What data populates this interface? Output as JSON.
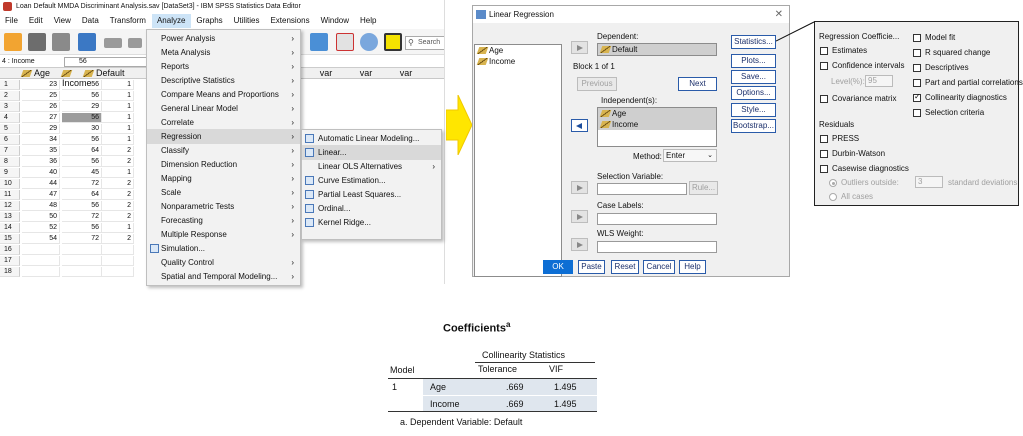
{
  "window": {
    "title": "Loan Default MMDA Discriminant Analysis.sav [DataSet3] - IBM SPSS Statistics Data Editor"
  },
  "menubar": [
    "File",
    "Edit",
    "View",
    "Data",
    "Transform",
    "Analyze",
    "Graphs",
    "Utilities",
    "Extensions",
    "Window",
    "Help"
  ],
  "toolbar": {
    "search_placeholder": "Search"
  },
  "cellbar": {
    "cell": "4 : Income",
    "value": "56"
  },
  "grid": {
    "columns": [
      "Age",
      "Income",
      "Default",
      "var",
      "var",
      "var",
      "var"
    ],
    "rows": [
      {
        "n": "1",
        "age": "23",
        "income": "56",
        "def": "1"
      },
      {
        "n": "2",
        "age": "25",
        "income": "56",
        "def": "1"
      },
      {
        "n": "3",
        "age": "26",
        "income": "29",
        "def": "1"
      },
      {
        "n": "4",
        "age": "27",
        "income": "56",
        "def": "1"
      },
      {
        "n": "5",
        "age": "29",
        "income": "30",
        "def": "1"
      },
      {
        "n": "6",
        "age": "34",
        "income": "56",
        "def": "1"
      },
      {
        "n": "7",
        "age": "35",
        "income": "64",
        "def": "2"
      },
      {
        "n": "8",
        "age": "36",
        "income": "56",
        "def": "2"
      },
      {
        "n": "9",
        "age": "40",
        "income": "45",
        "def": "1"
      },
      {
        "n": "10",
        "age": "44",
        "income": "72",
        "def": "2"
      },
      {
        "n": "11",
        "age": "47",
        "income": "64",
        "def": "2"
      },
      {
        "n": "12",
        "age": "48",
        "income": "56",
        "def": "2"
      },
      {
        "n": "13",
        "age": "50",
        "income": "72",
        "def": "2"
      },
      {
        "n": "14",
        "age": "52",
        "income": "56",
        "def": "1"
      },
      {
        "n": "15",
        "age": "54",
        "income": "72",
        "def": "2"
      },
      {
        "n": "16",
        "age": "",
        "income": "",
        "def": ""
      },
      {
        "n": "17",
        "age": "",
        "income": "",
        "def": ""
      },
      {
        "n": "18",
        "age": "",
        "income": "",
        "def": ""
      }
    ]
  },
  "analyze_menu": [
    {
      "label": "Power Analysis",
      "sub": true
    },
    {
      "label": "Meta Analysis",
      "sub": true
    },
    {
      "label": "Reports",
      "sub": true
    },
    {
      "label": "Descriptive Statistics",
      "sub": true
    },
    {
      "label": "Compare Means and Proportions",
      "sub": true
    },
    {
      "label": "General Linear Model",
      "sub": true
    },
    {
      "label": "Correlate",
      "sub": true
    },
    {
      "label": "Regression",
      "sub": true
    },
    {
      "label": "Classify",
      "sub": true
    },
    {
      "label": "Dimension Reduction",
      "sub": true
    },
    {
      "label": "Mapping",
      "sub": true
    },
    {
      "label": "Scale",
      "sub": true
    },
    {
      "label": "Nonparametric Tests",
      "sub": true
    },
    {
      "label": "Forecasting",
      "sub": true
    },
    {
      "label": "Multiple Response",
      "sub": true
    },
    {
      "label": "Simulation...",
      "sub": false
    },
    {
      "label": "Quality Control",
      "sub": true
    },
    {
      "label": "Spatial and Temporal Modeling...",
      "sub": true
    }
  ],
  "regression_menu": [
    {
      "label": "Automatic Linear Modeling...",
      "sub": false
    },
    {
      "label": "Linear...",
      "sub": false
    },
    {
      "label": "Linear OLS Alternatives",
      "sub": true
    },
    {
      "label": "Curve Estimation...",
      "sub": false
    },
    {
      "label": "Partial Least Squares...",
      "sub": false
    },
    {
      "label": "Ordinal...",
      "sub": false
    },
    {
      "label": "Kernel Ridge...",
      "sub": false
    }
  ],
  "dialog": {
    "title": "Linear Regression",
    "variables": [
      "Age",
      "Income"
    ],
    "dependent_label": "Dependent:",
    "dependent_value": "Default",
    "block_label": "Block 1 of 1",
    "previous": "Previous",
    "next": "Next",
    "independent_label": "Independent(s):",
    "independents": [
      "Age",
      "Income"
    ],
    "method_label": "Method:",
    "method_value": "Enter",
    "selection_label": "Selection Variable:",
    "rule": "Rule...",
    "case_labels": "Case Labels:",
    "wls": "WLS Weight:",
    "side_buttons": [
      "Statistics...",
      "Plots...",
      "Save...",
      "Options...",
      "Style...",
      "Bootstrap..."
    ],
    "bottom_buttons": [
      "OK",
      "Paste",
      "Reset",
      "Cancel",
      "Help"
    ]
  },
  "stats": {
    "coef_header": "Regression Coefficie...",
    "estimates": "Estimates",
    "conf": "Confidence intervals",
    "level_label": "Level(%):",
    "level_value": "95",
    "covmat": "Covariance matrix",
    "model_fit": "Model fit",
    "rsq": "R squared change",
    "descriptives": "Descriptives",
    "partcorr": "Part and partial correlations",
    "collin": "Collinearity diagnostics",
    "selcrit": "Selection criteria",
    "residuals": "Residuals",
    "press": "PRESS",
    "dw": "Durbin-Watson",
    "casewise": "Casewise diagnostics",
    "outliers": "Outliers outside:",
    "outliers_value": "3",
    "stddev": "standard deviations",
    "allcases": "All cases"
  },
  "coefficients": {
    "title": "Coefficients",
    "sup": "a",
    "group_header": "Collinearity Statistics",
    "col_model": "Model",
    "col_tol": "Tolerance",
    "col_vif": "VIF",
    "model_num": "1",
    "rows": [
      {
        "var": "Age",
        "tol": ".669",
        "vif": "1.495"
      },
      {
        "var": "Income",
        "tol": ".669",
        "vif": "1.495"
      }
    ],
    "footnote": "a. Dependent Variable: Default"
  },
  "colors": {
    "accent": "#0d6ed4",
    "arrow": "#ffe600",
    "table_band": "#dfe6ee"
  }
}
